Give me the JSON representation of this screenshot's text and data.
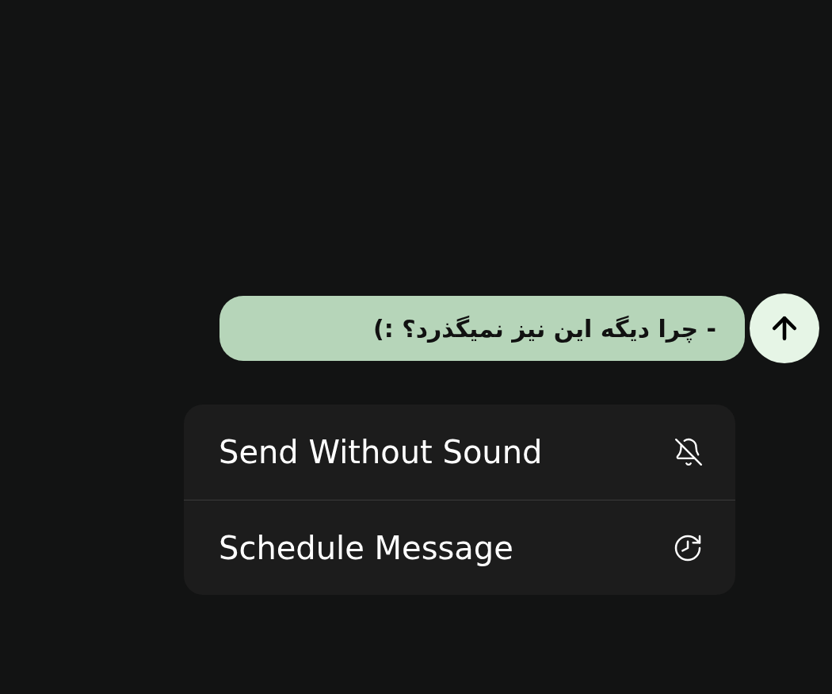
{
  "message": {
    "text": "- چرا دیگه این نیز نمیگذرد؟ :)"
  },
  "menu": [
    {
      "kind": "silent",
      "label": "Send Without Sound"
    },
    {
      "kind": "schedule",
      "label": "Schedule Message"
    }
  ]
}
